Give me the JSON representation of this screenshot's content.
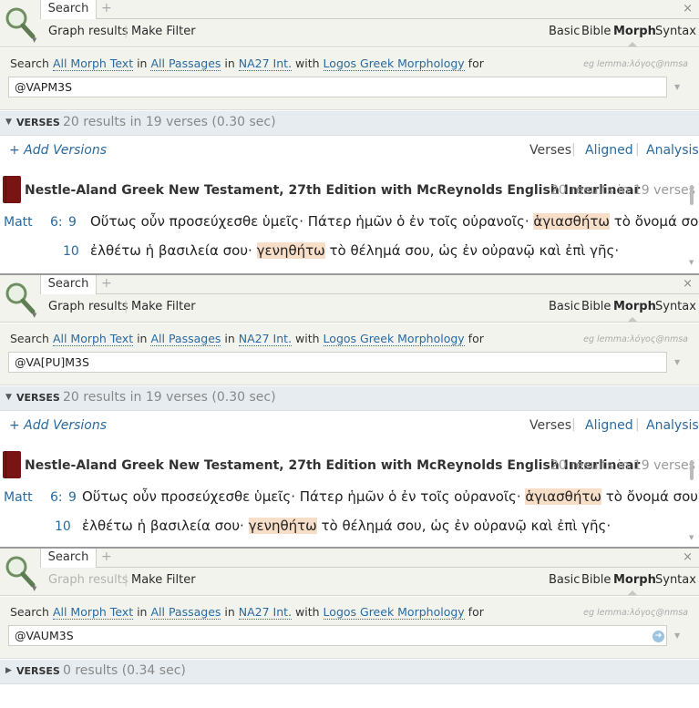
{
  "panels": [
    {
      "tab_label": "Search",
      "tab_add": "+",
      "tab_close": "×",
      "toolbar": {
        "graph_results": "Graph results",
        "make_filter": "Make Filter",
        "graph_disabled": false
      },
      "kinds": [
        "Basic",
        "Bible",
        "Morph",
        "Syntax"
      ],
      "active_kind": "Morph",
      "query": {
        "search": "Search",
        "text_type": "All Morph Text",
        "in1": "in",
        "passages": "All Passages",
        "in2": "in",
        "version": "NA27 Int.",
        "with": "with",
        "morphology": "Logos Greek Morphology",
        "for": "for",
        "example": "eg lemma:λόγος@nmsa",
        "input_value": "@VAPM3S"
      },
      "verses_bar": {
        "label": "VERSES",
        "count": "20 results in 19 verses (0.30 sec)"
      },
      "add_versions": "+ Add Versions",
      "views": {
        "verses": "Verses",
        "aligned": "Aligned",
        "analysis": "Analysis",
        "sep": "|"
      },
      "resource": {
        "title": "Nestle-Aland Greek New Testament, 27th Edition with McReynolds English Interlinear",
        "count": "20 results in 19 verses"
      },
      "verses": [
        {
          "book": "Matt",
          "chapter": "6:",
          "verse": "9",
          "before": "Οὕτως οὖν προσεύχεσθε ὑμεῖς· Πάτερ ἡμῶν ὁ ἐν τοῖς οὐρανοῖς·",
          "hit": "ἁγιασθήτω",
          "after": "τὸ ὄνομά σου·"
        },
        {
          "book": "",
          "chapter": "",
          "verse": "10",
          "before": "ἐλθέτω ἡ βασιλεία σου·",
          "hit": "γενηθήτω",
          "after": "τὸ θέλημά σου, ὡς ἐν οὐρανῷ καὶ ἐπὶ γῆς·"
        }
      ]
    },
    {
      "tab_label": "Search",
      "tab_add": "+",
      "tab_close": "×",
      "toolbar": {
        "graph_results": "Graph results",
        "make_filter": "Make Filter",
        "graph_disabled": false
      },
      "kinds": [
        "Basic",
        "Bible",
        "Morph",
        "Syntax"
      ],
      "active_kind": "Morph",
      "query": {
        "search": "Search",
        "text_type": "All Morph Text",
        "in1": "in",
        "passages": "All Passages",
        "in2": "in",
        "version": "NA27 Int.",
        "with": "with",
        "morphology": "Logos Greek Morphology",
        "for": "for",
        "example": "eg lemma:λόγος@nmsa",
        "input_value": "@VA[PU]M3S"
      },
      "verses_bar": {
        "label": "VERSES",
        "count": "20 results in 19 verses (0.30 sec)"
      },
      "add_versions": "+ Add Versions",
      "views": {
        "verses": "Verses",
        "aligned": "Aligned",
        "analysis": "Analysis",
        "sep": "|"
      },
      "resource": {
        "title": "Nestle-Aland Greek New Testament, 27th Edition with McReynolds English Interlinear",
        "count": "20 results in 19 verses"
      },
      "verses": [
        {
          "book": "Matt",
          "chapter": "6:",
          "verse": "9",
          "before": "Οὕτως οὖν προσεύχεσθε ὑμεῖς· Πάτερ ἡμῶν ὁ ἐν τοῖς οὐρανοῖς·",
          "hit": "ἁγιασθήτω",
          "after": "τὸ ὄνομά σου·"
        },
        {
          "book": "",
          "chapter": "",
          "verse": "10",
          "before": "ἐλθέτω ἡ βασιλεία σου·",
          "hit": "γενηθήτω",
          "after": "τὸ θέλημά σου, ὡς ἐν οὐρανῷ καὶ ἐπὶ γῆς·"
        }
      ]
    },
    {
      "tab_label": "Search",
      "tab_add": "+",
      "tab_close": "×",
      "toolbar": {
        "graph_results": "Graph results",
        "make_filter": "Make Filter",
        "graph_disabled": true
      },
      "kinds": [
        "Basic",
        "Bible",
        "Morph",
        "Syntax"
      ],
      "active_kind": "Morph",
      "query": {
        "search": "Search",
        "text_type": "All Morph Text",
        "in1": "in",
        "passages": "All Passages",
        "in2": "in",
        "version": "NA27 Int.",
        "with": "with",
        "morphology": "Logos Greek Morphology",
        "for": "for",
        "example": "eg lemma:λόγος@nmsa",
        "input_value": "@VAUM3S"
      },
      "verses_bar": {
        "label": "VERSES",
        "count": "0 results (0.34 sec)"
      }
    }
  ],
  "colors": {
    "link": "#2a6a9e",
    "highlight": "#f7dec9",
    "toolbar_bg": "#f3f3ee",
    "verses_bar_bg": "#e6ecf0",
    "book_icon": "#7a1414"
  },
  "icons": [
    "magnifier-icon",
    "book-icon",
    "go-arrow-icon",
    "dropdown-caret-icon",
    "close-icon",
    "add-tab-icon"
  ]
}
